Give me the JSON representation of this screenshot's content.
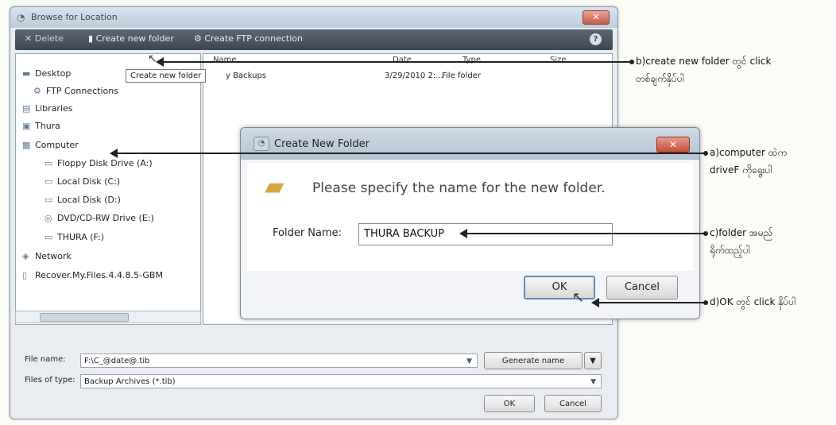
{
  "window": {
    "title": "Browse for Location",
    "close_glyph": "✕",
    "toolbar": {
      "delete_label": "Delete",
      "create_folder_label": "Create new folder",
      "ftp_label": "Create FTP connection",
      "help_glyph": "?"
    },
    "tooltip": "Create new folder",
    "tree": [
      {
        "label": "Desktop",
        "icon": "desktop-icon"
      },
      {
        "label": "FTP Connections",
        "icon": "ftp-icon"
      },
      {
        "label": "Libraries",
        "icon": "libraries-icon"
      },
      {
        "label": "Thura",
        "icon": "user-folder-icon"
      },
      {
        "label": "Computer",
        "icon": "computer-icon"
      },
      {
        "label": "Floppy Disk Drive (A:)",
        "icon": "floppy-icon"
      },
      {
        "label": "Local Disk (C:)",
        "icon": "disk-icon"
      },
      {
        "label": "Local Disk (D:)",
        "icon": "disk-icon"
      },
      {
        "label": "DVD/CD-RW Drive (E:)",
        "icon": "dvd-icon"
      },
      {
        "label": "THURA (F:)",
        "icon": "drive-icon"
      },
      {
        "label": "Network",
        "icon": "network-icon"
      },
      {
        "label": "Recover.My.Files.4.4.8.5-GBM",
        "icon": "folder-icon"
      }
    ],
    "list_columns": [
      "Name",
      "Date",
      "Type",
      "Size"
    ],
    "list_rows": [
      {
        "name": "y Backups",
        "date": "3/29/2010 2:...",
        "type": "File folder",
        "size": ""
      }
    ],
    "file_name_label": "File name:",
    "file_name_value": "F:\\C_@date@.tib",
    "generate_name_label": "Generate name",
    "files_of_type_label": "Files of type:",
    "files_of_type_value": "Backup Archives (*.tib)",
    "ok_label": "OK",
    "cancel_label": "Cancel"
  },
  "dialog": {
    "title": "Create New Folder",
    "message": "Please specify the name for the new folder.",
    "folder_name_label": "Folder Name:",
    "folder_name_value": "THURA BACKUP",
    "ok_label": "OK",
    "cancel_label": "Cancel",
    "close_glyph": "✕"
  },
  "annotations": {
    "b_line1": "b)create new folder တွင် click",
    "b_line2": "တစ်ချက်နှိပ်ပါ",
    "a_line1": "a)computer ထဲက",
    "a_line2": "driveF ကိုရွေးပါ",
    "c_line1": "c)folder အမည်",
    "c_line2": "ရိုက်ထည့်ပါ",
    "d_line1": "d)OK တွင် click နှိပ်ပါ"
  }
}
